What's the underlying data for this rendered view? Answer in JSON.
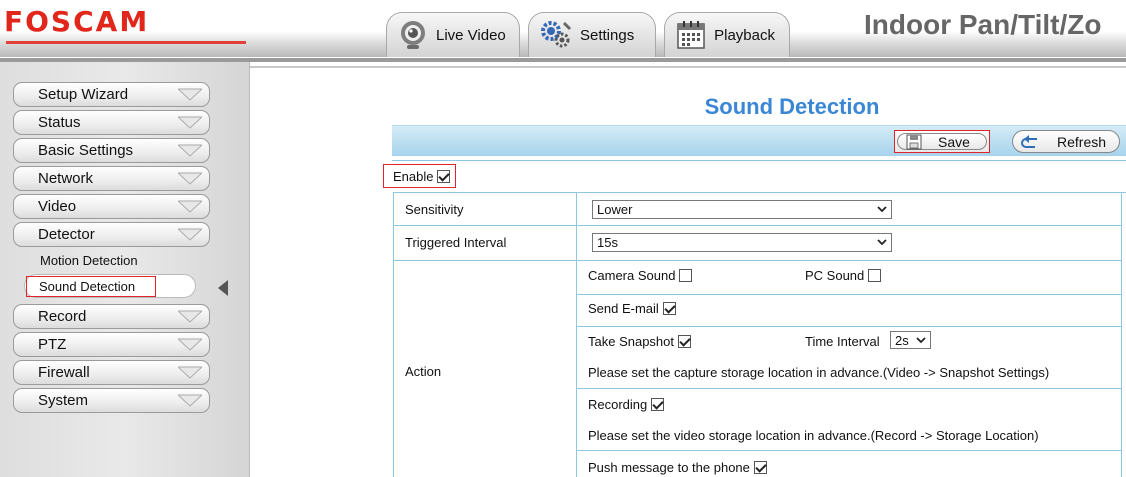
{
  "header": {
    "logo": "FOSCAM",
    "product_title": "Indoor Pan/Tilt/Zo",
    "tabs": [
      {
        "label": "Live Video",
        "icon": "webcam-icon"
      },
      {
        "label": "Settings",
        "icon": "gears-icon"
      },
      {
        "label": "Playback",
        "icon": "calendar-icon"
      }
    ]
  },
  "sidebar": {
    "items": [
      "Setup Wizard",
      "Status",
      "Basic Settings",
      "Network",
      "Video",
      "Detector"
    ],
    "detector_sub": [
      "Motion Detection",
      "Sound Detection"
    ],
    "active_sub": "Sound Detection",
    "items_after": [
      "Record",
      "PTZ",
      "Firewall",
      "System"
    ]
  },
  "main": {
    "title": "Sound Detection",
    "save_label": "Save",
    "refresh_label": "Refresh",
    "enable_label": "Enable",
    "enable_checked": true,
    "sensitivity_label": "Sensitivity",
    "sensitivity_value": "Lower",
    "interval_label": "Triggered Interval",
    "interval_value": "15s",
    "action_label": "Action",
    "camera_sound_label": "Camera Sound",
    "camera_sound_checked": false,
    "pc_sound_label": "PC Sound",
    "pc_sound_checked": false,
    "send_email_label": "Send E-mail",
    "send_email_checked": true,
    "take_snapshot_label": "Take Snapshot",
    "take_snapshot_checked": true,
    "time_interval_label": "Time Interval",
    "time_interval_value": "2s",
    "snapshot_note": "Please set the capture storage location in advance.(Video -> Snapshot Settings)",
    "recording_label": "Recording",
    "recording_checked": true,
    "recording_note": "Please set the video storage location in advance.(Record -> Storage Location)",
    "push_label": "Push message to the phone",
    "push_checked": true
  },
  "colors": {
    "brand_red": "#e1261c",
    "title_blue": "#3a87d6",
    "toolbar_blue": "#a6d3ec",
    "highlight_red": "#e0242a"
  }
}
